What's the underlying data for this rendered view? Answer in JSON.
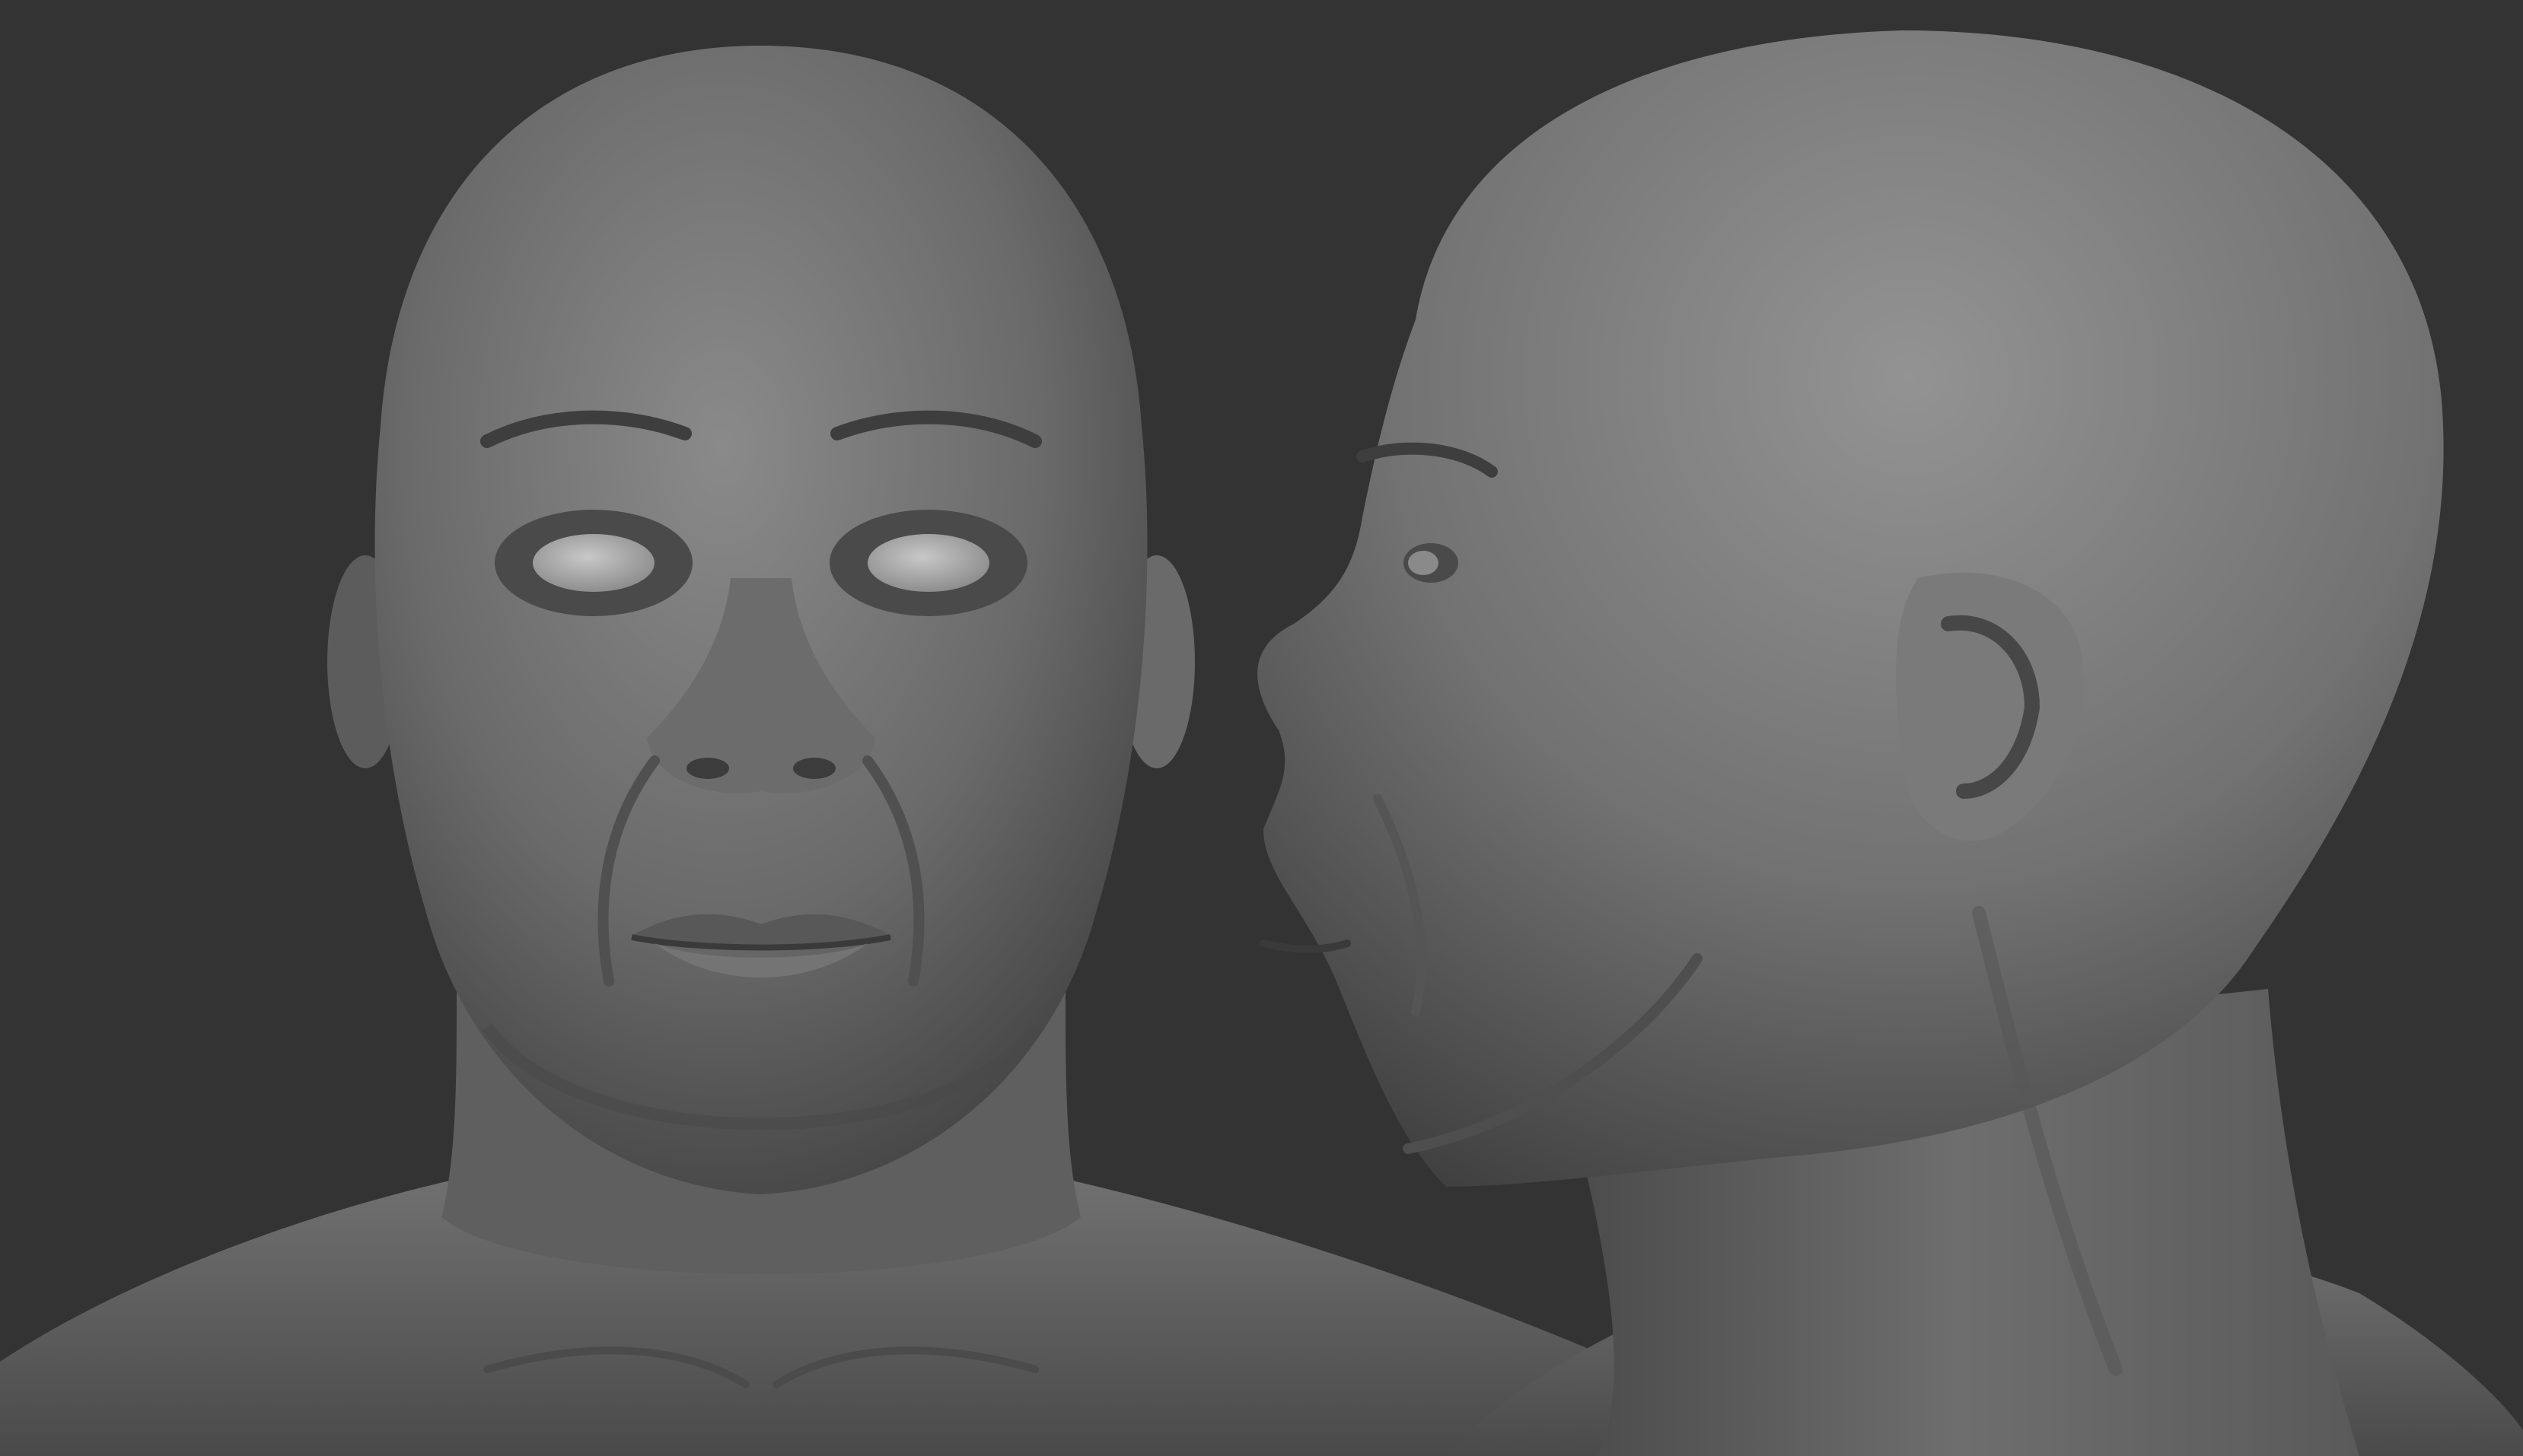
{
  "scene": {
    "background_color": "#333333",
    "clay_color": "#6b6b6b",
    "highlight_color": "#8f8f8f",
    "shadow_color": "#2a2a2a",
    "eye_color": "#b5b5b5",
    "views": [
      {
        "name": "front-view"
      },
      {
        "name": "side-profile-view"
      }
    ]
  }
}
